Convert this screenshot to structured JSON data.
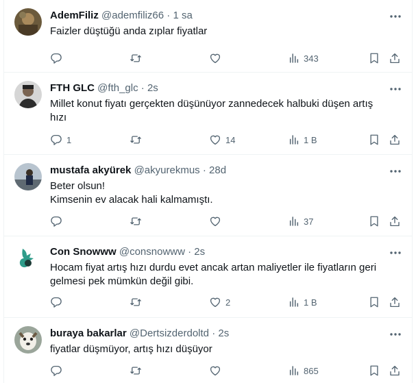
{
  "tweets": [
    {
      "name": "AdemFiliz",
      "handle": "@ademfiliz66",
      "time": "1 sa",
      "lines": [
        "Faizler düştüğü anda zıplar fiyatlar"
      ],
      "replies": "",
      "retweets": "",
      "likes": "",
      "views": "343"
    },
    {
      "name": "FTH GLC",
      "handle": "@fth_glc",
      "time": "2s",
      "lines": [
        "Millet konut fiyatı gerçekten düşünüyor zannedecek halbuki düşen artış",
        "hızı"
      ],
      "replies": "1",
      "retweets": "",
      "likes": "14",
      "views": "1 B"
    },
    {
      "name": "mustafa akyürek",
      "handle": "@akyurekmus",
      "time": "28d",
      "lines": [
        "Beter olsun!",
        "Kimsenin ev alacak hali kalmamıştı."
      ],
      "replies": "",
      "retweets": "",
      "likes": "",
      "views": "37"
    },
    {
      "name": "Con Snowww",
      "handle": "@consnowww",
      "time": "2s",
      "lines": [
        "Hocam fiyat artış hızı durdu evet ancak artan maliyetler ile fiyatların geri",
        "gelmesi pek mümkün değil gibi."
      ],
      "replies": "",
      "retweets": "",
      "likes": "2",
      "views": "1 B"
    },
    {
      "name": "buraya bakarlar",
      "handle": "@Dertsizderdoltd",
      "time": "2s",
      "lines": [
        "fiyatlar düşmüyor, artış hızı düşüyor"
      ],
      "replies": "",
      "retweets": "",
      "likes": "",
      "views": "865"
    }
  ],
  "separator": "·",
  "colors": {
    "text": "#0f1419",
    "muted": "#536471",
    "border": "#eff3f4"
  }
}
